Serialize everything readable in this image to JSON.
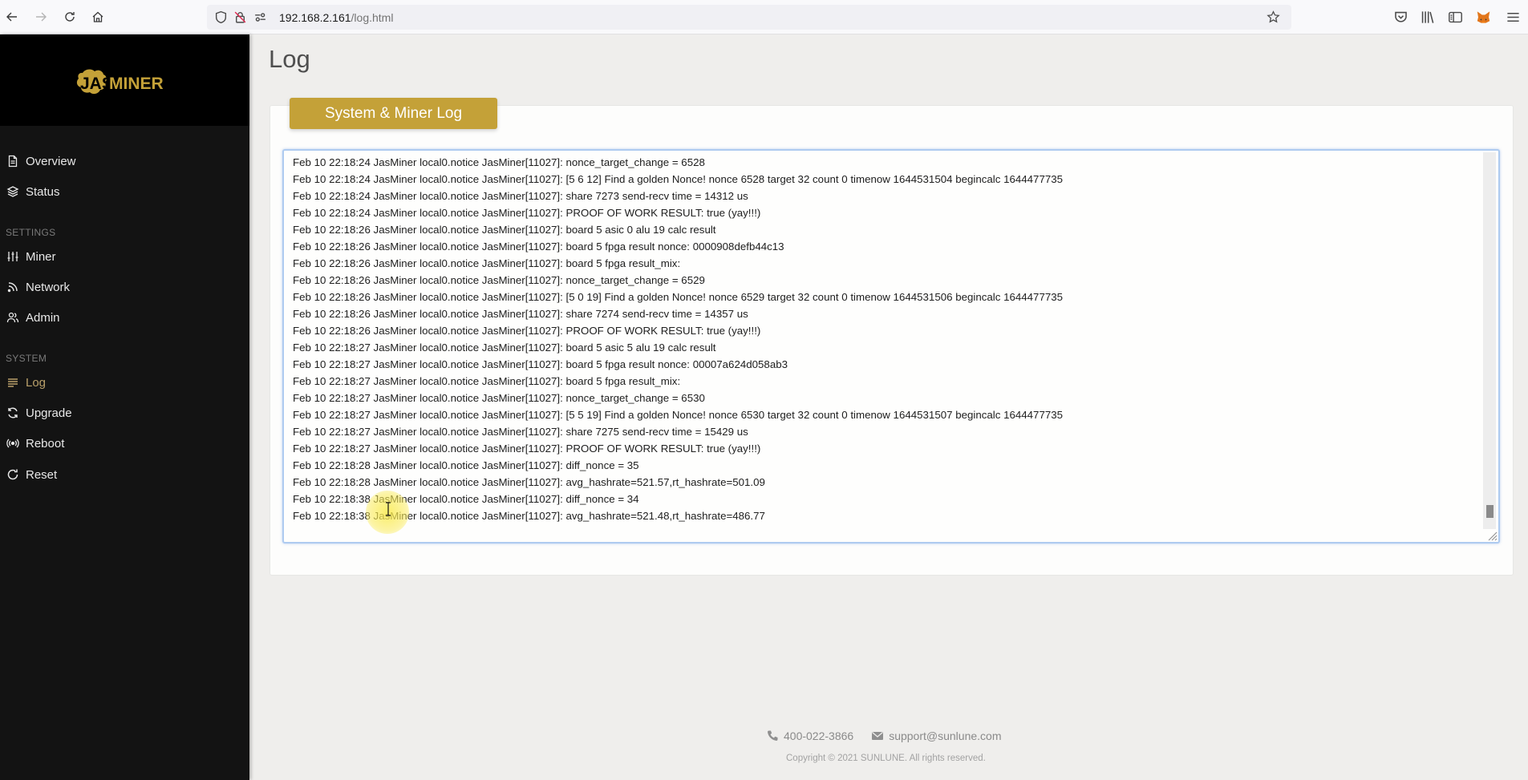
{
  "browser": {
    "url_host": "192.168.2.161",
    "url_path": "/log.html"
  },
  "sidebar": {
    "logo_text": "JASMINER",
    "brand_color": "#c4a138",
    "items_main": [
      {
        "label": "Overview",
        "icon": "document-icon"
      },
      {
        "label": "Status",
        "icon": "layers-icon"
      }
    ],
    "section_settings": "SETTINGS",
    "items_settings": [
      {
        "label": "Miner",
        "icon": "sliders-icon"
      },
      {
        "label": "Network",
        "icon": "rss-icon"
      },
      {
        "label": "Admin",
        "icon": "users-icon"
      }
    ],
    "section_system": "SYSTEM",
    "items_system": [
      {
        "label": "Log",
        "icon": "lines-icon",
        "active": true
      },
      {
        "label": "Upgrade",
        "icon": "refresh-icon"
      },
      {
        "label": "Reboot",
        "icon": "broadcast-icon"
      },
      {
        "label": "Reset",
        "icon": "rotate-icon"
      }
    ]
  },
  "main": {
    "title": "Log",
    "card_tab": "System & Miner Log",
    "log_lines": [
      "Feb 10 22:18:24 JasMiner local0.notice JasMiner[11027]: nonce_target_change = 6528",
      "Feb 10 22:18:24 JasMiner local0.notice JasMiner[11027]: [5 6 12] Find a golden Nonce! nonce 6528 target 32 count 0 timenow 1644531504 begincalc 1644477735",
      "Feb 10 22:18:24 JasMiner local0.notice JasMiner[11027]: share 7273 send-recv time = 14312 us",
      "Feb 10 22:18:24 JasMiner local0.notice JasMiner[11027]: PROOF OF WORK RESULT: true (yay!!!)",
      "Feb 10 22:18:26 JasMiner local0.notice JasMiner[11027]: board 5 asic 0 alu 19 calc result",
      "Feb 10 22:18:26 JasMiner local0.notice JasMiner[11027]: board 5 fpga result nonce: 0000908defb44c13",
      "Feb 10 22:18:26 JasMiner local0.notice JasMiner[11027]: board 5 fpga result_mix:",
      "Feb 10 22:18:26 JasMiner local0.notice JasMiner[11027]: nonce_target_change = 6529",
      "Feb 10 22:18:26 JasMiner local0.notice JasMiner[11027]: [5 0 19] Find a golden Nonce! nonce 6529 target 32 count 0 timenow 1644531506 begincalc 1644477735",
      "Feb 10 22:18:26 JasMiner local0.notice JasMiner[11027]: share 7274 send-recv time = 14357 us",
      "Feb 10 22:18:26 JasMiner local0.notice JasMiner[11027]: PROOF OF WORK RESULT: true (yay!!!)",
      "Feb 10 22:18:27 JasMiner local0.notice JasMiner[11027]: board 5 asic 5 alu 19 calc result",
      "Feb 10 22:18:27 JasMiner local0.notice JasMiner[11027]: board 5 fpga result nonce: 00007a624d058ab3",
      "Feb 10 22:18:27 JasMiner local0.notice JasMiner[11027]: board 5 fpga result_mix:",
      "Feb 10 22:18:27 JasMiner local0.notice JasMiner[11027]: nonce_target_change = 6530",
      "Feb 10 22:18:27 JasMiner local0.notice JasMiner[11027]: [5 5 19] Find a golden Nonce! nonce 6530 target 32 count 0 timenow 1644531507 begincalc 1644477735",
      "Feb 10 22:18:27 JasMiner local0.notice JasMiner[11027]: share 7275 send-recv time = 15429 us",
      "Feb 10 22:18:27 JasMiner local0.notice JasMiner[11027]: PROOF OF WORK RESULT: true (yay!!!)",
      "Feb 10 22:18:28 JasMiner local0.notice JasMiner[11027]: diff_nonce = 35",
      "Feb 10 22:18:28 JasMiner local0.notice JasMiner[11027]: avg_hashrate=521.57,rt_hashrate=501.09",
      "Feb 10 22:18:38 JasMiner local0.notice JasMiner[11027]: diff_nonce = 34",
      "Feb 10 22:18:38 JasMiner local0.notice JasMiner[11027]: avg_hashrate=521.48,rt_hashrate=486.77"
    ],
    "scroll_position": 0.98
  },
  "footer": {
    "phone": "400-022-3866",
    "email": "support@sunlune.com",
    "copyright": "Copyright © 2021 SUNLUNE. All rights reserved."
  }
}
